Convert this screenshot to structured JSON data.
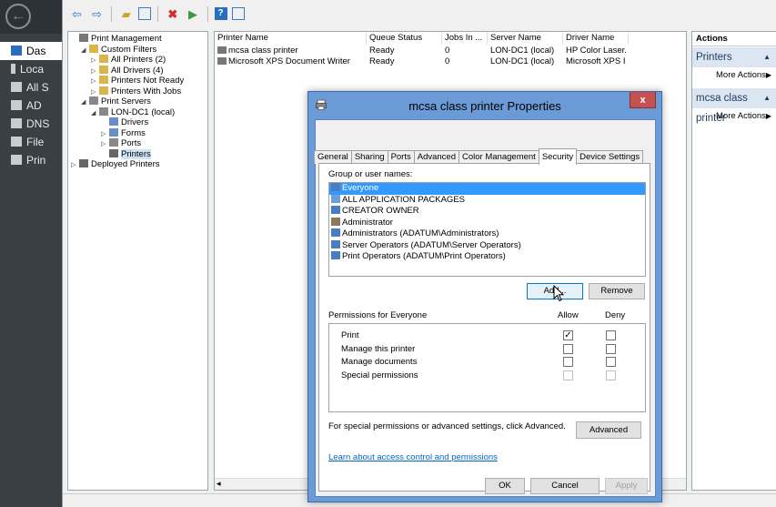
{
  "server_manager": {
    "nav": [
      {
        "label": "Das",
        "active": true
      },
      {
        "label": "Loca",
        "active": false
      },
      {
        "label": "All S",
        "active": false
      },
      {
        "label": "AD",
        "active": false
      },
      {
        "label": "DNS",
        "active": false
      },
      {
        "label": "File",
        "active": false
      },
      {
        "label": "Prin",
        "active": false
      }
    ]
  },
  "mmc": {
    "tree": [
      {
        "label": "Print Management",
        "indent": 0,
        "exp": "",
        "icon": "printer-mgmt-icon"
      },
      {
        "label": "Custom Filters",
        "indent": 1,
        "exp": "◢",
        "icon": "filter-folder-icon"
      },
      {
        "label": "All Printers (2)",
        "indent": 2,
        "exp": "▷",
        "icon": "filter-icon"
      },
      {
        "label": "All Drivers (4)",
        "indent": 2,
        "exp": "▷",
        "icon": "filter-icon"
      },
      {
        "label": "Printers Not Ready",
        "indent": 2,
        "exp": "▷",
        "icon": "filter-icon"
      },
      {
        "label": "Printers With Jobs",
        "indent": 2,
        "exp": "▷",
        "icon": "filter-icon"
      },
      {
        "label": "Print Servers",
        "indent": 1,
        "exp": "◢",
        "icon": "server-icon"
      },
      {
        "label": "LON-DC1 (local)",
        "indent": 2,
        "exp": "◢",
        "icon": "server-icon"
      },
      {
        "label": "Drivers",
        "indent": 3,
        "exp": "",
        "icon": "driver-icon"
      },
      {
        "label": "Forms",
        "indent": 3,
        "exp": "▷",
        "icon": "forms-icon"
      },
      {
        "label": "Ports",
        "indent": 3,
        "exp": "▷",
        "icon": "port-icon"
      },
      {
        "label": "Printers",
        "indent": 3,
        "exp": "",
        "icon": "printer-icon",
        "selected": true
      },
      {
        "label": "Deployed Printers",
        "indent": 0,
        "exp": "▷",
        "icon": "printer-icon"
      }
    ],
    "list_columns": [
      "Printer Name",
      "Queue Status",
      "Jobs In ...",
      "Server Name",
      "Driver Name"
    ],
    "list_rows": [
      [
        "mcsa class printer",
        "Ready",
        "0",
        "LON-DC1 (local)",
        "HP Color Laser."
      ],
      [
        "Microsoft XPS Document Writer",
        "Ready",
        "0",
        "LON-DC1 (local)",
        "Microsoft XPS I"
      ]
    ],
    "actions": {
      "header": "Actions",
      "sections": [
        {
          "title": "Printers",
          "items": [
            "More Actions"
          ]
        },
        {
          "title": "mcsa class printer",
          "items": [
            "More Actions"
          ]
        }
      ]
    }
  },
  "dialog": {
    "title": "mcsa class printer Properties",
    "close_label": "x",
    "tabs": [
      "General",
      "Sharing",
      "Ports",
      "Advanced",
      "Color Management",
      "Security",
      "Device Settings"
    ],
    "active_tab": "Security",
    "group_label": "Group or user names:",
    "users": [
      {
        "name": "Everyone",
        "selected": true
      },
      {
        "name": "ALL APPLICATION PACKAGES",
        "selected": false
      },
      {
        "name": "CREATOR OWNER",
        "selected": false
      },
      {
        "name": "Administrator",
        "selected": false
      },
      {
        "name": "Administrators (ADATUM\\Administrators)",
        "selected": false
      },
      {
        "name": "Server Operators (ADATUM\\Server Operators)",
        "selected": false
      },
      {
        "name": "Print Operators (ADATUM\\Print Operators)",
        "selected": false
      }
    ],
    "add_label": "Add...",
    "remove_label": "Remove",
    "permissions_label": "Permissions for Everyone",
    "allow_label": "Allow",
    "deny_label": "Deny",
    "permissions": [
      {
        "name": "Print",
        "allow": true,
        "deny": false,
        "disabled": false
      },
      {
        "name": "Manage this printer",
        "allow": false,
        "deny": false,
        "disabled": false
      },
      {
        "name": "Manage documents",
        "allow": false,
        "deny": false,
        "disabled": false
      },
      {
        "name": "Special permissions",
        "allow": false,
        "deny": false,
        "disabled": true
      }
    ],
    "special_text": "For special permissions or advanced settings, click Advanced.",
    "advanced_label": "Advanced",
    "learn_link": "Learn about access control and permissions",
    "ok_label": "OK",
    "cancel_label": "Cancel",
    "apply_label": "Apply"
  }
}
